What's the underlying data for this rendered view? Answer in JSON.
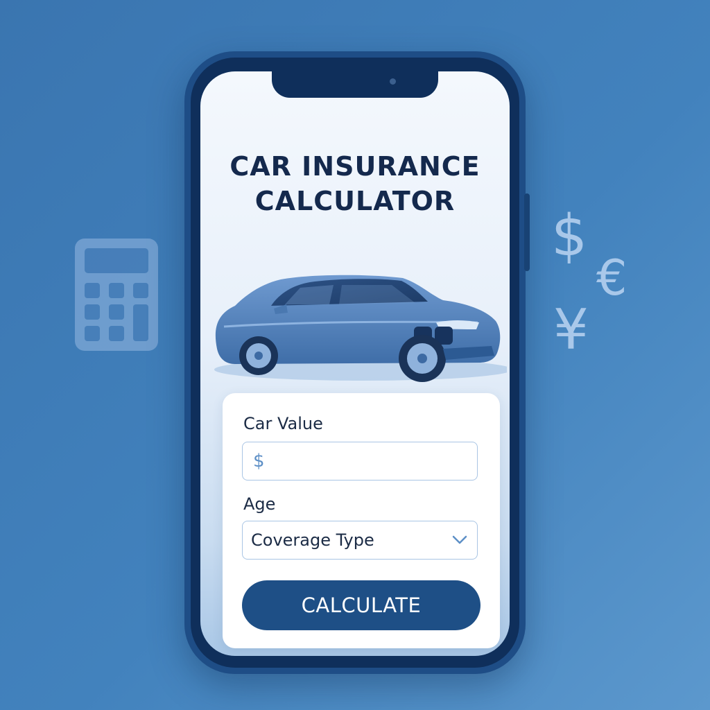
{
  "app": {
    "title_line1": "CAR INSURANCE",
    "title_line2": "CALCULATOR"
  },
  "form": {
    "car_value_label": "Car Value",
    "car_value_prefix": "$",
    "car_value_input": "",
    "age_label": "Age",
    "coverage_select": "Coverage Type",
    "calculate_label": "CALCULATE"
  },
  "decor": {
    "currency_dollar": "$",
    "currency_euro": "€",
    "currency_yen": "¥",
    "calculator_icon": "calculator-icon",
    "car_image": "sedan-car-illustration"
  },
  "colors": {
    "background": "#4282bd",
    "phone_frame": "#1e4d86",
    "button": "#1e4f86",
    "title_text": "#14294d",
    "accent": "#5d8fc6"
  }
}
